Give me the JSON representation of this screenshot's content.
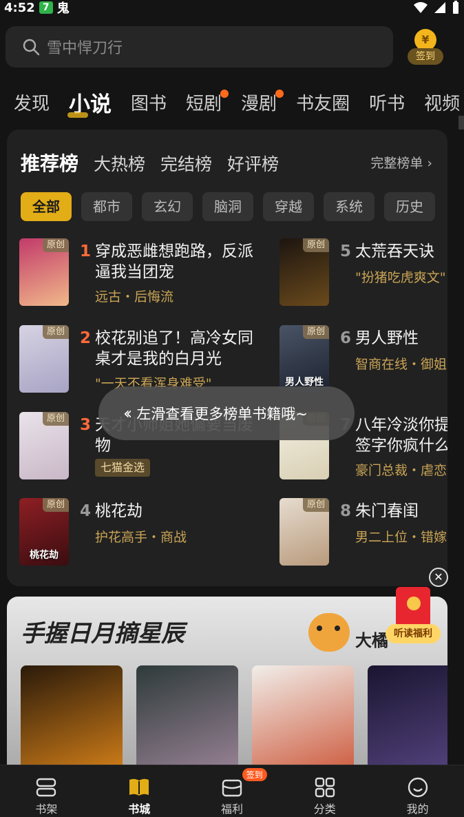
{
  "status_bar": {
    "time": "4:52",
    "badge": "7",
    "glyph": "鬼"
  },
  "search": {
    "placeholder": "雪中悍刀行"
  },
  "signin": {
    "coin_symbol": "¥",
    "label": "签到"
  },
  "top_tabs": [
    {
      "label": "发现",
      "active": false,
      "dot": false
    },
    {
      "label": "小说",
      "active": true,
      "dot": false
    },
    {
      "label": "图书",
      "active": false,
      "dot": false
    },
    {
      "label": "短剧",
      "active": false,
      "dot": true
    },
    {
      "label": "漫剧",
      "active": false,
      "dot": true
    },
    {
      "label": "书友圈",
      "active": false,
      "dot": false
    },
    {
      "label": "听书",
      "active": false,
      "dot": false
    },
    {
      "label": "视频",
      "active": false,
      "dot": false
    }
  ],
  "ranking": {
    "tabs": [
      "推荐榜",
      "大热榜",
      "完结榜",
      "好评榜"
    ],
    "full_link": "完整榜单 ›",
    "chips": [
      "全部",
      "都市",
      "玄幻",
      "脑洞",
      "穿越",
      "系统",
      "历史"
    ],
    "original_tag": "原创",
    "books": [
      {
        "rank": "1",
        "title": "穿成恶雌想跑路，反派逼我当团宠",
        "subtitle": "远古・后悔流",
        "cover_text": "",
        "colors": [
          "#c23a6a",
          "#f1b98a"
        ]
      },
      {
        "rank": "2",
        "title": "校花别追了！高冷女同桌才是我的白月光",
        "subtitle": "\"一天不看浑身难受\"",
        "cover_text": "",
        "colors": [
          "#d7d3e3",
          "#a7a3c4"
        ]
      },
      {
        "rank": "3",
        "title": "天才小师姐她偏要当废物",
        "subtitle": "",
        "badge": "七猫金选",
        "cover_text": "",
        "colors": [
          "#e9e3ea",
          "#c9b7c7"
        ]
      },
      {
        "rank": "4",
        "title": "桃花劫",
        "subtitle": "护花高手・商战",
        "cover_text": "桃花劫",
        "colors": [
          "#8e1f24",
          "#3a0d10"
        ]
      },
      {
        "rank": "5",
        "title": "太荒吞天诀",
        "subtitle": "\"扮猪吃虎爽文\"",
        "cover_text": "",
        "colors": [
          "#1d1510",
          "#6a4a1c"
        ]
      },
      {
        "rank": "6",
        "title": "男人野性",
        "subtitle": "智商在线・御姐",
        "cover_text": "男人野性",
        "colors": [
          "#4a5466",
          "#1c2230"
        ]
      },
      {
        "rank": "7",
        "title": "八年冷淡你提签字你疯什么",
        "subtitle": "豪门总裁・虐恋",
        "cover_text": "",
        "colors": [
          "#f3efe2",
          "#d8cfb3"
        ]
      },
      {
        "rank": "8",
        "title": "朱门春闺",
        "subtitle": "男二上位・错嫁",
        "cover_text": "",
        "colors": [
          "#e6dccf",
          "#b89a7c"
        ]
      }
    ]
  },
  "toast": {
    "arrows": "‹‹",
    "text": "左滑查看更多榜单书籍哦~"
  },
  "close_symbol": "✕",
  "redpacket": {
    "label": "听读福利"
  },
  "banner": {
    "slogan": "手握日月摘星辰",
    "cat_name": "大橘",
    "covers": [
      {
        "colors": [
          "#2a1a0a",
          "#e58a1a"
        ]
      },
      {
        "colors": [
          "#2e3b3a",
          "#a58aa0"
        ]
      },
      {
        "colors": [
          "#f1eeea",
          "#c94a2a"
        ]
      },
      {
        "colors": [
          "#1a1530",
          "#5d4a8a"
        ]
      }
    ]
  },
  "bottom_nav": [
    {
      "label": "书架",
      "icon": "bookshelf-icon",
      "active": false
    },
    {
      "label": "书城",
      "icon": "bookstore-icon",
      "active": true
    },
    {
      "label": "福利",
      "icon": "gift-box-icon",
      "active": false,
      "badge": "签到"
    },
    {
      "label": "分类",
      "icon": "grid-icon",
      "active": false
    },
    {
      "label": "我的",
      "icon": "profile-icon",
      "active": false
    }
  ],
  "colors": {
    "accent": "#e2ad16",
    "rank_top": "#ff6a3a",
    "rank_other": "#9a9a9a"
  }
}
